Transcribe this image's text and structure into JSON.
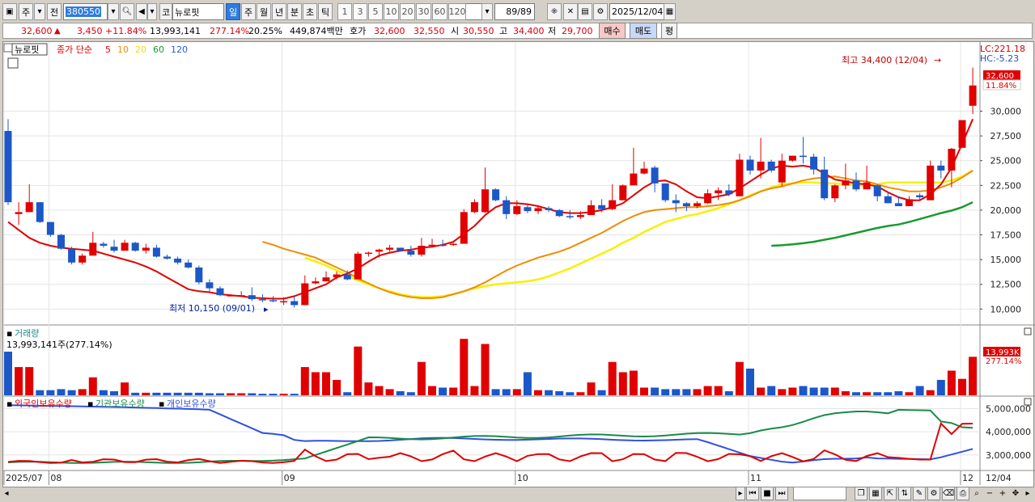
{
  "toolbar": {
    "market_type": "주",
    "jeon": "전",
    "code": "380550",
    "ko_btn": "코",
    "name": "뉴로핏",
    "periods": [
      "일",
      "주",
      "월",
      "년",
      "분",
      "초",
      "틱"
    ],
    "period_selected": "일",
    "minutes": [
      "1",
      "3",
      "5",
      "10",
      "20",
      "30",
      "60",
      "120"
    ],
    "page": "89/89",
    "date": "2025/12/04"
  },
  "quote": {
    "price": "32,600",
    "arrow": "▲",
    "change": "3,450",
    "change_pct": "+11.84%",
    "volume": "13,993,141",
    "volume_ratio": "277.14%",
    "turnover": "20.25%",
    "amount": "449,874백만",
    "bid_label": "호가",
    "ask": "32,600",
    "bid": "32,550",
    "open_label": "시",
    "open": "30,550",
    "high_label": "고",
    "high": "34,400",
    "low_label": "저",
    "low": "29,700",
    "buy_label": "매수",
    "sell_label": "매도",
    "eval_label": "평"
  },
  "chart_data": [
    {
      "type": "candlestick",
      "title": "뉴로핏",
      "legend_prefix": "종가 단순",
      "ma_periods": [
        {
          "period": "5",
          "color": "#e00000"
        },
        {
          "period": "10",
          "color": "#f08c00"
        },
        {
          "period": "20",
          "color": "#f0e000"
        },
        {
          "period": "60",
          "color": "#1a9a30"
        },
        {
          "period": "120",
          "color": "#2060e0"
        }
      ],
      "ylim": [
        8800,
        36500
      ],
      "y_ticks": [
        "30,000",
        "27,500",
        "25,000",
        "22,500",
        "20,000",
        "17,500",
        "15,000",
        "12,500",
        "10,000"
      ],
      "y_tick_values": [
        30000,
        27500,
        25000,
        22500,
        20000,
        17500,
        15000,
        12500,
        10000
      ],
      "right_top": [
        "LC:221.18",
        "HC:-5.23"
      ],
      "price_tag": "32,600",
      "pct_tag": "11.84%",
      "max_note": "최고 34,400 (12/04)",
      "min_note": "최저 10,150 (09/01)",
      "ohlc": [
        [
          28000,
          29200,
          20500,
          20800
        ],
        [
          19600,
          20800,
          18500,
          19800
        ],
        [
          19800,
          22600,
          19800,
          20800
        ],
        [
          20800,
          20800,
          18700,
          18800
        ],
        [
          18800,
          18800,
          17300,
          17500
        ],
        [
          17500,
          17600,
          16000,
          16100
        ],
        [
          16100,
          16300,
          14500,
          14700
        ],
        [
          14700,
          15600,
          14500,
          15400
        ],
        [
          15400,
          17800,
          15400,
          16700
        ],
        [
          16600,
          16800,
          16200,
          16400
        ],
        [
          16300,
          17000,
          15700,
          15900
        ],
        [
          15900,
          17000,
          15900,
          16700
        ],
        [
          16700,
          16800,
          15800,
          15900
        ],
        [
          15900,
          16600,
          15600,
          16200
        ],
        [
          16200,
          16500,
          15200,
          15300
        ],
        [
          15300,
          15500,
          15000,
          15100
        ],
        [
          15100,
          15300,
          14500,
          14700
        ],
        [
          14700,
          15000,
          14100,
          14200
        ],
        [
          14200,
          14400,
          12500,
          12700
        ],
        [
          12700,
          13000,
          11800,
          12100
        ],
        [
          12100,
          12300,
          11300,
          11400
        ],
        [
          11400,
          11500,
          11300,
          11400
        ],
        [
          11400,
          11800,
          11300,
          11400
        ],
        [
          11400,
          12200,
          10800,
          11000
        ],
        [
          11000,
          11500,
          10700,
          10900
        ],
        [
          10900,
          11300,
          10700,
          10800
        ],
        [
          10800,
          11200,
          10400,
          10800
        ],
        [
          10800,
          11300,
          10150,
          10400
        ],
        [
          10400,
          13400,
          10400,
          12600
        ],
        [
          12600,
          13200,
          12500,
          12800
        ],
        [
          12800,
          13800,
          12800,
          13200
        ],
        [
          13200,
          13800,
          13000,
          13500
        ],
        [
          13500,
          13900,
          12900,
          13000
        ],
        [
          13000,
          15800,
          13000,
          15600
        ],
        [
          15600,
          15800,
          15300,
          15700
        ],
        [
          15800,
          16100,
          15200,
          16000
        ],
        [
          16000,
          16500,
          15800,
          16200
        ],
        [
          16200,
          16200,
          15800,
          15900
        ],
        [
          15900,
          16400,
          15300,
          15500
        ],
        [
          15500,
          17200,
          15300,
          16400
        ],
        [
          16400,
          17100,
          16200,
          16500
        ],
        [
          16500,
          17000,
          16300,
          16400
        ],
        [
          16500,
          16700,
          16400,
          16600
        ],
        [
          16600,
          20100,
          16600,
          19800
        ],
        [
          19800,
          21100,
          19700,
          20800
        ],
        [
          19800,
          24300,
          19700,
          22100
        ],
        [
          22100,
          22200,
          20900,
          21000
        ],
        [
          21000,
          21400,
          19100,
          19600
        ],
        [
          19600,
          21000,
          19500,
          20400
        ],
        [
          20300,
          20600,
          19700,
          19900
        ],
        [
          19900,
          20400,
          19600,
          20200
        ],
        [
          20200,
          20400,
          19800,
          20000
        ],
        [
          20000,
          20100,
          19300,
          19400
        ],
        [
          19400,
          20000,
          19100,
          19300
        ],
        [
          19300,
          19900,
          19100,
          19500
        ],
        [
          19500,
          21000,
          19500,
          20500
        ],
        [
          20500,
          21100,
          19800,
          20100
        ],
        [
          20100,
          22600,
          20000,
          21000
        ],
        [
          21000,
          22600,
          21000,
          22500
        ],
        [
          22500,
          26300,
          22500,
          23700
        ],
        [
          23700,
          24900,
          23600,
          24200
        ],
        [
          24300,
          24500,
          21800,
          22700
        ],
        [
          22700,
          22700,
          20800,
          21000
        ],
        [
          21000,
          21600,
          19800,
          20700
        ],
        [
          20700,
          20800,
          19900,
          20400
        ],
        [
          20400,
          20900,
          20200,
          20700
        ],
        [
          20700,
          22100,
          20600,
          21700
        ],
        [
          21700,
          22300,
          21000,
          22000
        ],
        [
          22000,
          22600,
          21400,
          21600
        ],
        [
          21400,
          25700,
          21400,
          25100
        ],
        [
          25100,
          25500,
          23600,
          24000
        ],
        [
          24000,
          27300,
          23200,
          24900
        ],
        [
          24900,
          25100,
          23800,
          24000
        ],
        [
          22800,
          25700,
          22400,
          25000
        ],
        [
          25000,
          25500,
          24900,
          25500
        ],
        [
          25500,
          27400,
          24700,
          25400
        ],
        [
          25400,
          25700,
          23600,
          24100
        ],
        [
          24100,
          25400,
          21000,
          21200
        ],
        [
          21200,
          22600,
          20800,
          22500
        ],
        [
          22500,
          24700,
          22100,
          23000
        ],
        [
          23000,
          23800,
          21900,
          22100
        ],
        [
          22100,
          24500,
          22100,
          22800
        ],
        [
          22500,
          22600,
          20900,
          21400
        ],
        [
          21400,
          21800,
          20700,
          20700
        ],
        [
          20700,
          21400,
          20400,
          20400
        ],
        [
          20400,
          21400,
          20400,
          21100
        ],
        [
          21500,
          21700,
          21000,
          21300
        ],
        [
          21000,
          25000,
          21000,
          24500
        ],
        [
          24500,
          25000,
          23200,
          24000
        ],
        [
          24000,
          26300,
          22300,
          26200
        ],
        [
          26300,
          29000,
          26300,
          29100
        ],
        [
          30550,
          34400,
          29700,
          32600
        ]
      ],
      "ma5": [
        18800,
        18000,
        17200,
        16700,
        16400,
        16200,
        16100,
        16000,
        15900,
        15600,
        15300,
        15000,
        14700,
        14300,
        13800,
        13200,
        12600,
        12000,
        11800,
        11700,
        11500,
        11400,
        11300,
        11150,
        11100,
        11050,
        11050,
        11300,
        11700,
        12100,
        12500,
        13200,
        13600,
        14100,
        14800,
        15400,
        15700,
        15900,
        16000,
        16200,
        16300,
        16500,
        16800,
        17600,
        18400,
        19500,
        20300,
        20700,
        20700,
        20600,
        20400,
        20100,
        19800,
        19700,
        19700,
        19800,
        20000,
        20300,
        20700,
        21500,
        22300,
        22900,
        23000,
        22600,
        21900,
        21300,
        21200,
        21400,
        21600,
        22200,
        22900,
        23600,
        24200,
        24500,
        24400,
        24500,
        24300,
        23700,
        23100,
        22900,
        22700,
        22600,
        22400,
        21800,
        21300,
        21000,
        21000,
        21600,
        22600,
        24300,
        26700,
        29200
      ],
      "ma10": [
        16800,
        16500,
        16100,
        15800,
        15500,
        15200,
        14700,
        14200,
        13700,
        13100,
        12600,
        12100,
        11700,
        11400,
        11200,
        11100,
        11100,
        11200,
        11500,
        11800,
        12200,
        12700,
        13300,
        13900,
        14400,
        14800,
        15200,
        15500,
        15800,
        16200,
        16700,
        17200,
        17700,
        18300,
        18900,
        19400,
        19800,
        20000,
        20100,
        20200,
        20300,
        20300,
        20400,
        20500,
        20700,
        21000,
        21400,
        21900,
        22200,
        22400,
        22700,
        23000,
        23200,
        23300,
        23400,
        23200,
        23000,
        22900,
        22600,
        22300,
        22100,
        21900,
        21900,
        22000,
        22300,
        22700,
        23300,
        24000
      ],
      "ma20": [
        15200,
        14800,
        14400,
        13900,
        13400,
        12900,
        12500,
        12100,
        11800,
        11500,
        11300,
        11200,
        11200,
        11300,
        11500,
        11800,
        12100,
        12300,
        12500,
        12600,
        12700,
        12800,
        13000,
        13300,
        13700,
        14100,
        14600,
        15100,
        15600,
        16100,
        16700,
        17200,
        17800,
        18300,
        18800,
        19100,
        19400,
        19600,
        19900,
        20200,
        20600,
        21000,
        21500,
        21900,
        22300,
        22600,
        22700,
        22800,
        22800,
        22700,
        22700,
        22600,
        22500,
        22500,
        22600,
        22800,
        22800,
        22800,
        22800,
        22800,
        22800,
        23000,
        23400,
        24000
      ],
      "ma60": [
        16400,
        16450,
        16550,
        16650,
        16800,
        17000,
        17200,
        17450,
        17700,
        17950,
        18200,
        18400,
        18550,
        18800,
        19100,
        19400,
        19700,
        19950,
        20300,
        20800
      ]
    },
    {
      "type": "bar",
      "title": "거래량",
      "value_text": "13,993,141주(277.14%)",
      "tag_value": "13,993K",
      "tag_pct": "277.14%",
      "volume_relative": [
        0.85,
        0.55,
        0.55,
        0.1,
        0.1,
        0.12,
        0.1,
        0.12,
        0.35,
        0.1,
        0.08,
        0.25,
        0.05,
        0.05,
        0.05,
        0.05,
        0.05,
        0.05,
        0.05,
        0.04,
        0.04,
        0.04,
        0.04,
        0.04,
        0.03,
        0.03,
        0.03,
        0.03,
        0.55,
        0.45,
        0.45,
        0.3,
        0.06,
        0.95,
        0.25,
        0.18,
        0.12,
        0.08,
        0.06,
        0.65,
        0.18,
        0.15,
        0.15,
        1.1,
        0.18,
        1.0,
        0.12,
        0.12,
        0.12,
        0.45,
        0.1,
        0.1,
        0.08,
        0.06,
        0.06,
        0.25,
        0.1,
        0.65,
        0.45,
        0.48,
        0.15,
        0.15,
        0.12,
        0.12,
        0.12,
        0.12,
        0.18,
        0.18,
        0.08,
        0.65,
        0.52,
        0.15,
        0.18,
        0.12,
        0.15,
        0.18,
        0.15,
        0.15,
        0.15,
        0.08,
        0.06,
        0.06,
        0.06,
        0.06,
        0.08,
        0.06,
        0.18,
        0.1,
        0.3,
        0.48,
        0.32,
        0.75
      ]
    },
    {
      "type": "line",
      "series": [
        {
          "name": "외국인보유수량",
          "color": "#e00000"
        },
        {
          "name": "기관보유수량",
          "color": "#1a8a4a"
        },
        {
          "name": "개인보유수량",
          "color": "#3050e0"
        }
      ],
      "ylim": [
        2400000,
        5400000
      ],
      "y_ticks": [
        "5,000,000",
        "4,000,000",
        "3,000,000"
      ],
      "y_tick_values": [
        5000000,
        4000000,
        3000000
      ]
    }
  ],
  "x_axis": {
    "labels": [
      "2025/07",
      "08",
      "09",
      "10",
      "11",
      "12"
    ],
    "right_date": "12/04"
  }
}
